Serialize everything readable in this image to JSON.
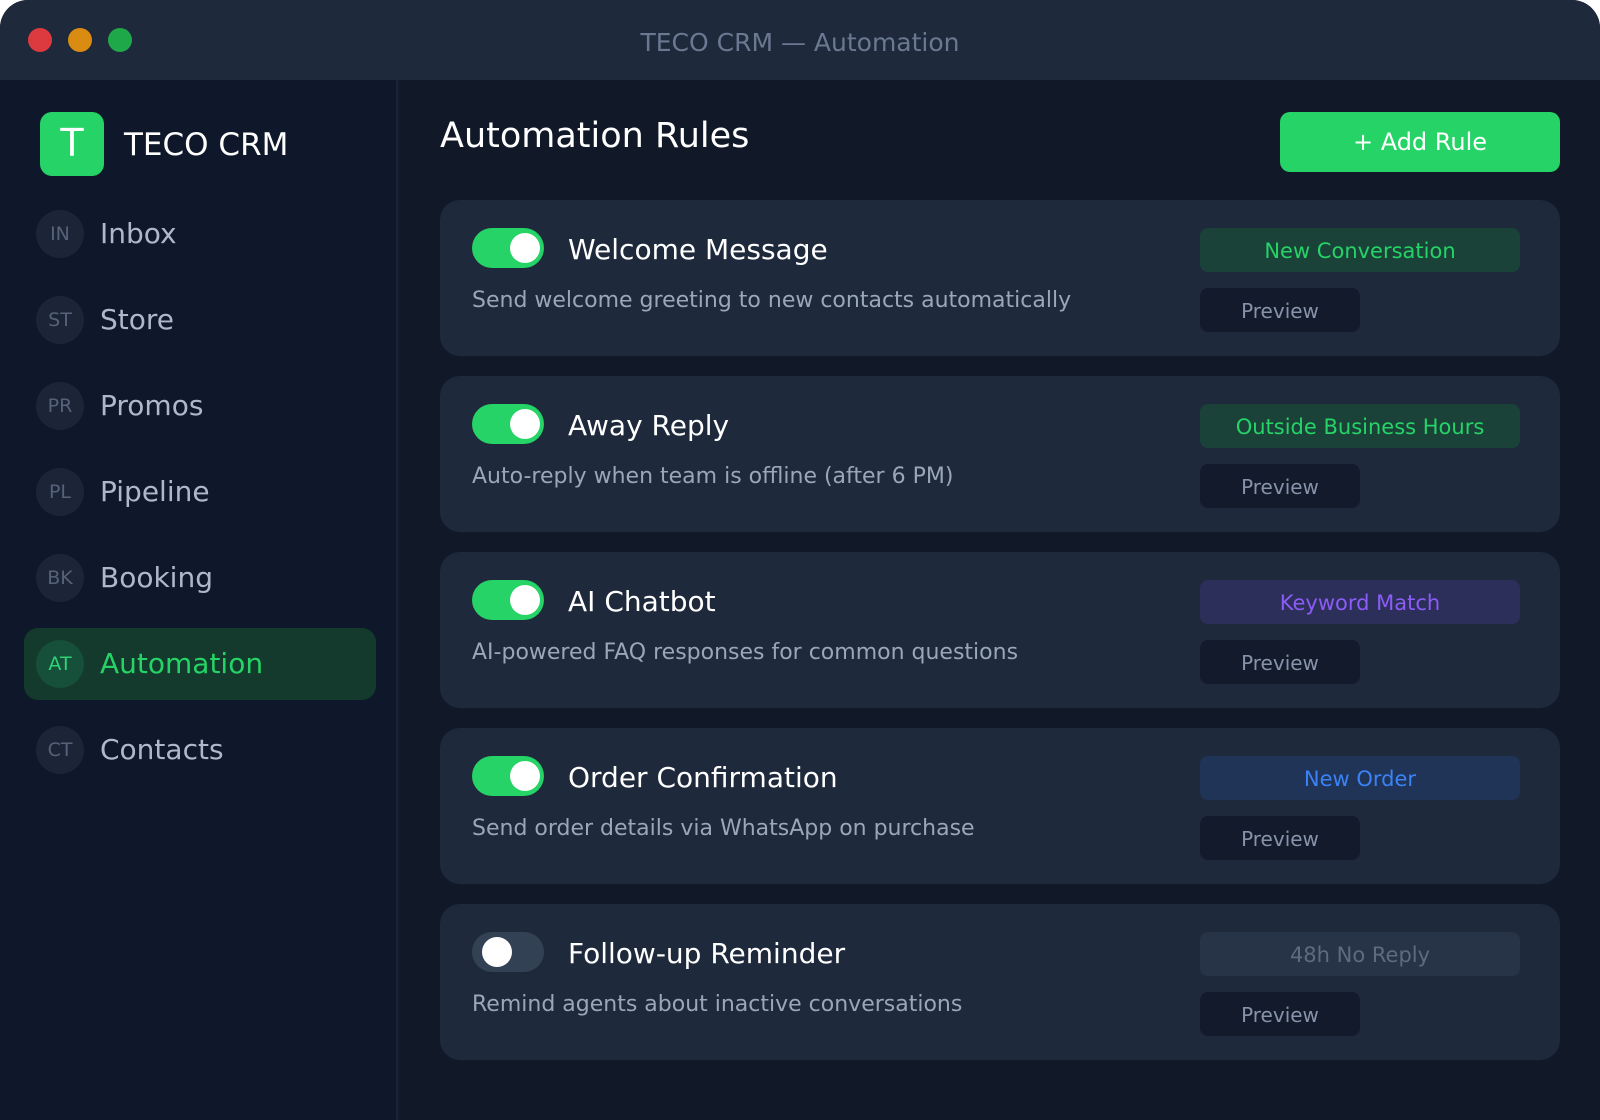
{
  "window": {
    "title": "TECO CRM — Automation"
  },
  "sidebar": {
    "brand": {
      "logo_letter": "T",
      "name": "TECO CRM"
    },
    "items": [
      {
        "badge": "IN",
        "label": "Inbox",
        "active": false
      },
      {
        "badge": "ST",
        "label": "Store",
        "active": false
      },
      {
        "badge": "PR",
        "label": "Promos",
        "active": false
      },
      {
        "badge": "PL",
        "label": "Pipeline",
        "active": false
      },
      {
        "badge": "BK",
        "label": "Booking",
        "active": false
      },
      {
        "badge": "AT",
        "label": "Automation",
        "active": true
      },
      {
        "badge": "CT",
        "label": "Contacts",
        "active": false
      }
    ]
  },
  "main": {
    "title": "Automation Rules",
    "add_button_label": "+ Add Rule",
    "preview_label": "Preview",
    "rules": [
      {
        "name": "Welcome Message",
        "description": "Send welcome greeting to new contacts automatically",
        "enabled": true,
        "trigger": "New Conversation",
        "trigger_color": "#25d366",
        "trigger_bg": "#1a4239"
      },
      {
        "name": "Away Reply",
        "description": "Auto-reply when team is offline (after 6 PM)",
        "enabled": true,
        "trigger": "Outside Business Hours",
        "trigger_color": "#25d366",
        "trigger_bg": "#1a4239"
      },
      {
        "name": "AI Chatbot",
        "description": "AI-powered FAQ responses for common questions",
        "enabled": true,
        "trigger": "Keyword Match",
        "trigger_color": "#8b5cf6",
        "trigger_bg": "#2c2f59"
      },
      {
        "name": "Order Confirmation",
        "description": "Send order details via WhatsApp on purchase",
        "enabled": true,
        "trigger": "New Order",
        "trigger_color": "#3b82f6",
        "trigger_bg": "#1f3457"
      },
      {
        "name": "Follow-up Reminder",
        "description": "Remind agents about inactive conversations",
        "enabled": false,
        "trigger": "48h No Reply",
        "trigger_color": "#5e6a80",
        "trigger_bg": "#273346"
      }
    ]
  },
  "colors": {
    "accent": "#25d366"
  }
}
